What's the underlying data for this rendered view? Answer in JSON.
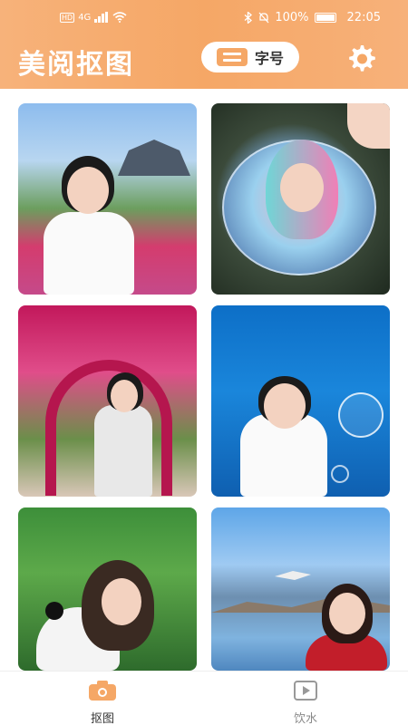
{
  "status_bar": {
    "network": "HD",
    "signal": "4G",
    "battery_pct": "100%",
    "time": "22:05"
  },
  "header": {
    "title": "美阅抠图",
    "font_button_label": "字号"
  },
  "tabs": [
    {
      "label": "抠图",
      "active": true
    },
    {
      "label": "饮水",
      "active": false
    }
  ],
  "colors": {
    "accent": "#f5a766",
    "tab_active": "#f5a766",
    "tab_inactive": "#999999"
  }
}
